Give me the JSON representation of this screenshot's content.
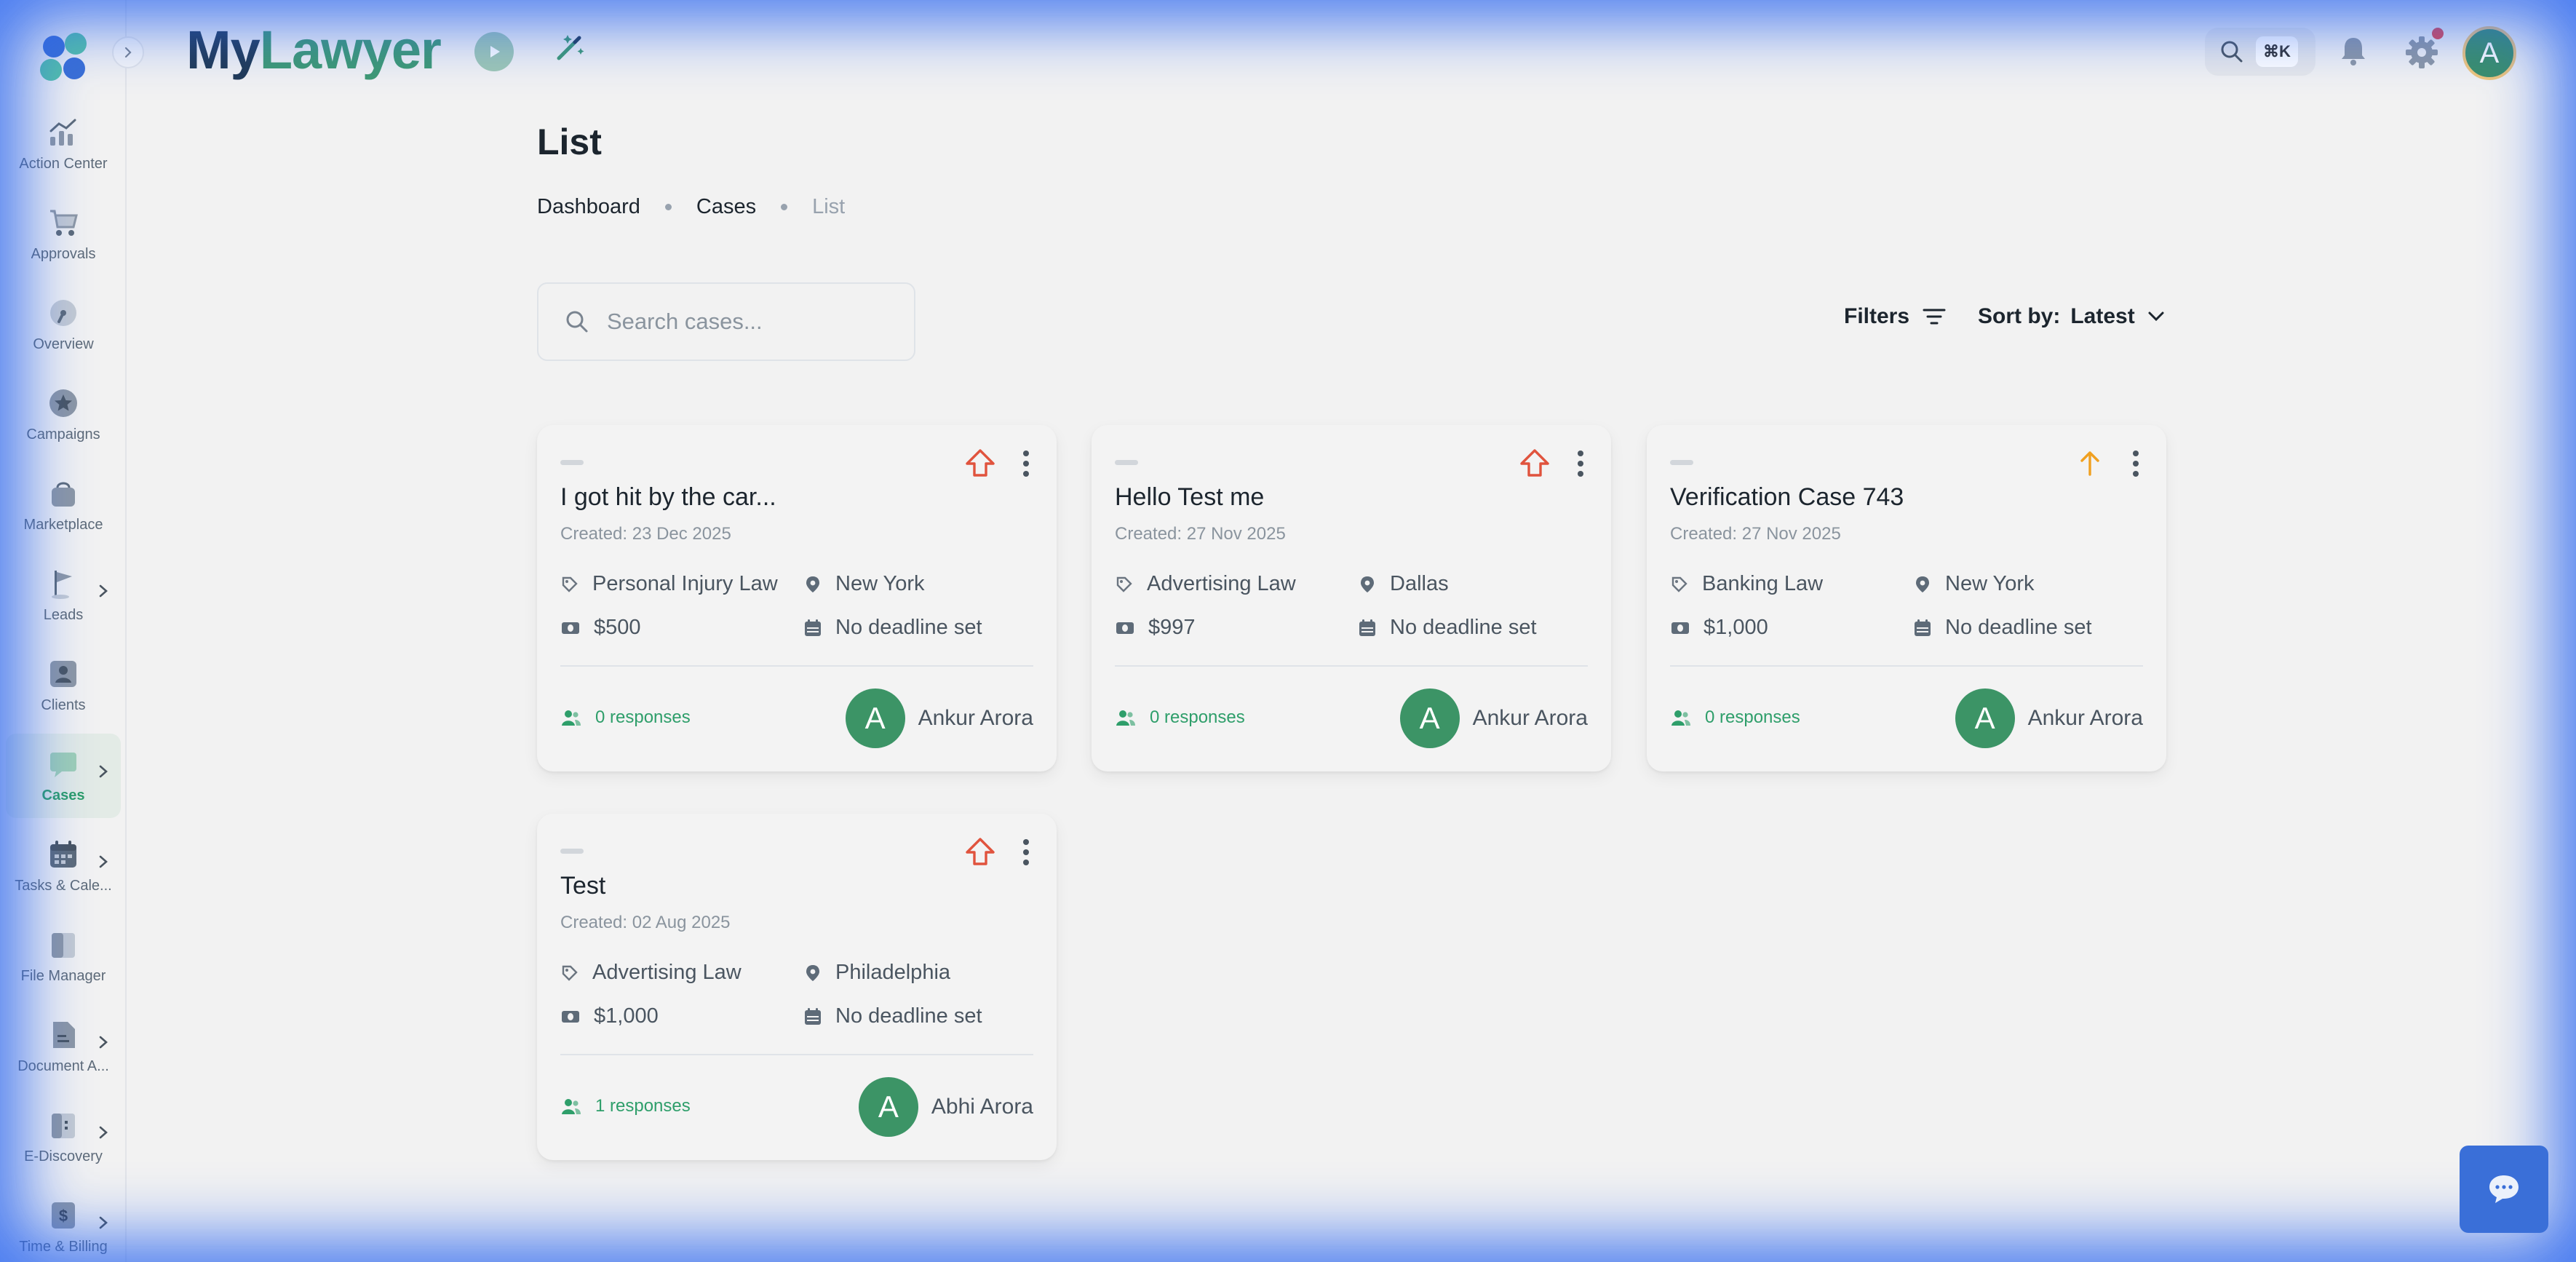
{
  "app": {
    "brand_part1": "My",
    "brand_part2": "Lawyer",
    "accent_color": "#3f9a72",
    "brand_dark": "#213a55"
  },
  "header": {
    "search_shortcut": "⌘K",
    "avatar_letter": "A",
    "notification_dot_color": "#e5484d"
  },
  "sidebar": {
    "items": [
      {
        "label": "Action Center",
        "icon": "chart-trend-icon",
        "has_submenu": false,
        "active": false
      },
      {
        "label": "Approvals",
        "icon": "cart-icon",
        "has_submenu": false,
        "active": false
      },
      {
        "label": "Overview",
        "icon": "gauge-icon",
        "has_submenu": false,
        "active": false
      },
      {
        "label": "Campaigns",
        "icon": "star-badge-icon",
        "has_submenu": false,
        "active": false
      },
      {
        "label": "Marketplace",
        "icon": "bag-icon",
        "has_submenu": false,
        "active": false
      },
      {
        "label": "Leads",
        "icon": "flag-icon",
        "has_submenu": true,
        "active": false
      },
      {
        "label": "Clients",
        "icon": "user-card-icon",
        "has_submenu": false,
        "active": false
      },
      {
        "label": "Cases",
        "icon": "chat-board-icon",
        "has_submenu": true,
        "active": true
      },
      {
        "label": "Tasks & Cale...",
        "icon": "calendar-icon",
        "has_submenu": true,
        "active": false
      },
      {
        "label": "File Manager",
        "icon": "folder-icon",
        "has_submenu": false,
        "active": false
      },
      {
        "label": "Document A...",
        "icon": "document-icon",
        "has_submenu": true,
        "active": false
      },
      {
        "label": "E-Discovery",
        "icon": "folder-search-icon",
        "has_submenu": true,
        "active": false
      },
      {
        "label": "Time & Billing",
        "icon": "dollar-icon",
        "has_submenu": true,
        "active": false
      }
    ]
  },
  "page": {
    "title": "List",
    "breadcrumb": [
      "Dashboard",
      "Cases",
      "List"
    ]
  },
  "toolbar": {
    "search_placeholder": "Search cases...",
    "filters_label": "Filters",
    "sort_label": "Sort by:",
    "sort_value": "Latest"
  },
  "cases": [
    {
      "title": "I got hit by the car...",
      "created": "Created: 23 Dec 2025",
      "practice_area": "Personal Injury Law",
      "location": "New York",
      "budget": "$500",
      "deadline": "No deadline set",
      "responses": "0 responses",
      "owner_initial": "A",
      "owner": "Ankur Arora",
      "priority": "high"
    },
    {
      "title": "Hello Test me",
      "created": "Created: 27 Nov 2025",
      "practice_area": "Advertising Law",
      "location": "Dallas",
      "budget": "$997",
      "deadline": "No deadline set",
      "responses": "0 responses",
      "owner_initial": "A",
      "owner": "Ankur Arora",
      "priority": "high"
    },
    {
      "title": "Verification Case 743",
      "created": "Created: 27 Nov 2025",
      "practice_area": "Banking Law",
      "location": "New York",
      "budget": "$1,000",
      "deadline": "No deadline set",
      "responses": "0 responses",
      "owner_initial": "A",
      "owner": "Ankur Arora",
      "priority": "medium"
    },
    {
      "title": "Test",
      "created": "Created: 02 Aug 2025",
      "practice_area": "Advertising Law",
      "location": "Philadelphia",
      "budget": "$1,000",
      "deadline": "No deadline set",
      "responses": "1 responses",
      "owner_initial": "A",
      "owner": "Abhi Arora",
      "priority": "high"
    }
  ],
  "colors": {
    "priority_high": "#e0533d",
    "priority_medium": "#f0a020",
    "responses_green": "#2e9e6a",
    "chat_button": "#3a6fd8"
  }
}
